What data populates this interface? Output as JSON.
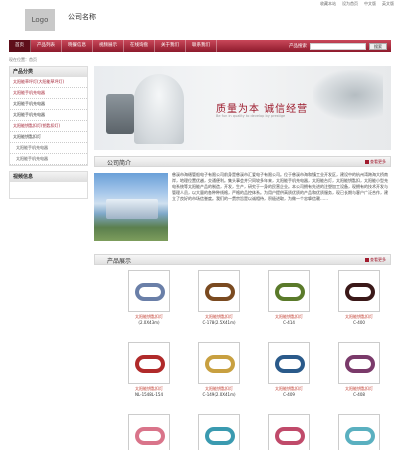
{
  "top_links": [
    "收藏本站",
    "设为首页",
    "中文版",
    "英文版"
  ],
  "logo_text": "Logo",
  "company_name": "公司名称",
  "nav": {
    "items": [
      "首页",
      "产品列表",
      "晓餐信息",
      "视频展示",
      "在线询盘",
      "关于我们",
      "联系我们"
    ],
    "search_label": "产品搜索",
    "search_placeholder": "",
    "search_button": "搜索"
  },
  "breadcrumb": "现在位置：首页",
  "sidebar": {
    "category_title": "产品分类",
    "categories": [
      {
        "label": "太阳能草坪灯(大阳能草坪灯)",
        "style": "red"
      },
      {
        "label": "太阳能手机充电器",
        "style": "red"
      },
      {
        "label": "太阳能手机充电器",
        "style": "normal"
      },
      {
        "label": "太阳能手机充电器",
        "style": "normal"
      },
      {
        "label": "太阳能钥匙扣灯(钥匙扣灯)",
        "style": "red"
      },
      {
        "label": "太阳能钥匙扣灯",
        "style": "normal"
      },
      {
        "label": "太阳能手机充电器",
        "style": "sub"
      },
      {
        "label": "太阳能手机充电器",
        "style": "sub"
      }
    ],
    "contact_title": "视频信息"
  },
  "banner": {
    "slogan": "质量为本  诚信经营",
    "sub_en": "Be fun in quality to develop by prestige"
  },
  "about": {
    "title": "公司简介",
    "more": "查看更多",
    "text": "慈溪市海缙管船电子有限公司前身是慈溪市汇爱电子有限公司。位于慈溪市海和镇工业开发区，建设中的杭州湾跨海大桥南岸，地理位置优越，交通便利。集头事会并只同较多年来，太阳能手机充电器，太阳能台灯，太阳能钥匙扣，太阳能小型充电系统等太阳能产品的制造，开发，生产，研究于一身的民营企业。本公司拥有先进的注塑加工设备，现拥有的技术开发与管理人员，以大量的各种种线格，严格的品控体系。为用户提供高质优质的产品和优质服务，现已长期与客户广泛合作，建立了良好的市场信誉度。我们的一贯宗旨是以诚相待，积极进取，为做一个忠挚信赖……"
  },
  "products": {
    "title": "产品展示",
    "more": "查看更多",
    "items": [
      {
        "name": "太阳能钥匙扣灯",
        "code": "(2.0X43m)",
        "color": "#6a7fa8"
      },
      {
        "name": "太阳能钥匙扣灯",
        "code": "C-178(2.5X41m)",
        "color": "#7a4a20"
      },
      {
        "name": "太阳能钥匙扣灯",
        "code": "C-414",
        "color": "#5a7a2a"
      },
      {
        "name": "太阳能钥匙扣灯",
        "code": "C-400",
        "color": "#3a1818"
      },
      {
        "name": "太阳能钥匙扣灯",
        "code": "NL-1548L-154",
        "color": "#b02a2a"
      },
      {
        "name": "太阳能钥匙扣灯",
        "code": "C-149(2.0X41m)",
        "color": "#c8a040"
      },
      {
        "name": "太阳能钥匙扣灯",
        "code": "C-409",
        "color": "#2a5a8a"
      },
      {
        "name": "太阳能钥匙扣灯",
        "code": "C-408",
        "color": "#7a3a6a"
      },
      {
        "name": "",
        "code": "",
        "color": "#d9748a"
      },
      {
        "name": "",
        "code": "",
        "color": "#3a9ab0"
      },
      {
        "name": "",
        "code": "",
        "color": "#c04a6a"
      },
      {
        "name": "",
        "code": "",
        "color": "#5ab0c0"
      }
    ]
  },
  "colors": {
    "brand": "#9c1a2c",
    "nav_gradient_top": "#c9485a"
  }
}
